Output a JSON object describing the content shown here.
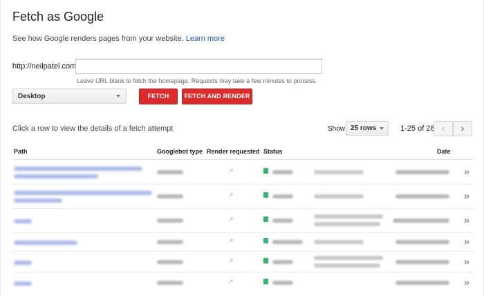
{
  "page": {
    "title": "Fetch as Google",
    "subtitle": "See how Google renders pages from your website.",
    "learn_more": "Learn more"
  },
  "form": {
    "url_prefix": "http://neilpatel.com/",
    "url_value": "",
    "hint": "Leave URL blank to fetch the homepage. Requests may take a few minutes to process.",
    "device": "Desktop",
    "fetch_label": "FETCH",
    "fetch_render_label": "FETCH AND RENDER"
  },
  "table_controls": {
    "instructions": "Click a row to view the details of a fetch attempt",
    "show_label": "Show",
    "rows_per_page": "25 rows",
    "range": "1-25 of 28"
  },
  "table": {
    "headers": {
      "path": "Path",
      "googlebot_type": "Googlebot type",
      "render_requested": "Render requested",
      "status": "Status",
      "date": "Date"
    },
    "row_chevron": "»",
    "colors": {
      "link": "#1a55c9",
      "status_ok": "#2fb96a",
      "button_red": "#dd2b2b"
    }
  }
}
